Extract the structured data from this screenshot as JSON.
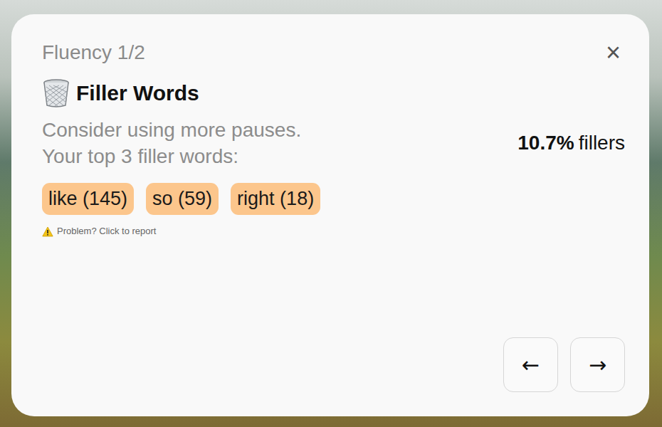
{
  "card": {
    "section": "Fluency 1/2",
    "close": "×",
    "title": "Filler Words",
    "hints": [
      "Consider using more pauses.",
      "Your top 3 filler words:"
    ],
    "ratio": {
      "value": "10.7%",
      "label": "fillers"
    },
    "filler_words": [
      {
        "label": "like (145)"
      },
      {
        "label": "so (59)"
      },
      {
        "label": "right (18)"
      }
    ],
    "report": "Problem? Click to report",
    "nav_buttons": [
      {
        "label": "←"
      },
      {
        "label": "→"
      }
    ]
  }
}
